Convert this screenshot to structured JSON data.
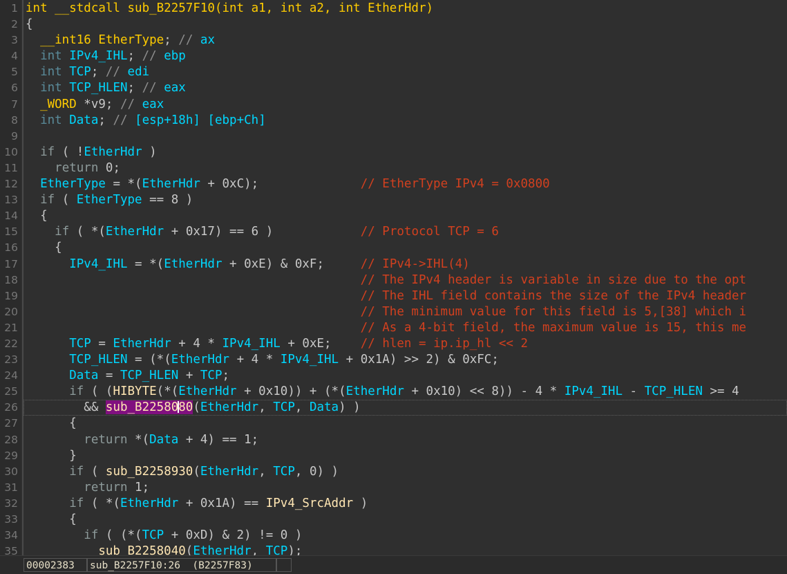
{
  "window": {
    "title": "IDA Pseudocode View",
    "background": "#2f2f2f",
    "gutter_background": "#2b2b2b"
  },
  "colors": {
    "background": "#2f2f2f",
    "gutter": "#2b2b2b",
    "line_number": "#767676",
    "declaration": "#ffcc00",
    "keyword": "#5a8b9a",
    "flow_keyword": "#8d9a9a",
    "variable": "#00d7ff",
    "function_name": "#ffe6b3",
    "comment": "#d1401f",
    "register_comment_slashes": "#8d8d8d",
    "register_name": "#00d7ff",
    "selection_highlight": "#80107f",
    "punctuation": "#c8c8c8",
    "caret": "#ffffff"
  },
  "editor": {
    "current_line": 26,
    "caret_token": "sub_B2258080",
    "caret_offset_in_token": 10,
    "first_line": 1,
    "last_line": 35,
    "total_visible_lines": 35
  },
  "code": {
    "lines": [
      {
        "n": 1,
        "tokens": [
          {
            "t": "int __stdcall sub_B2257F10(int a1, int a2, int EtherHdr)",
            "c": "t-decl"
          }
        ]
      },
      {
        "n": 2,
        "tokens": [
          {
            "t": "{",
            "c": "t-punct"
          }
        ]
      },
      {
        "n": 3,
        "tokens": [
          {
            "t": "  ",
            "c": "t-plain"
          },
          {
            "t": "__int16",
            "c": "t-type"
          },
          {
            "t": " ",
            "c": "t-plain"
          },
          {
            "t": "EtherType",
            "c": "t-type"
          },
          {
            "t": "; ",
            "c": "t-punct"
          },
          {
            "t": "//",
            "c": "t-rcmt-s"
          },
          {
            "t": " ",
            "c": "t-plain"
          },
          {
            "t": "ax",
            "c": "t-reg"
          }
        ]
      },
      {
        "n": 4,
        "tokens": [
          {
            "t": "  ",
            "c": "t-plain"
          },
          {
            "t": "int",
            "c": "t-kw"
          },
          {
            "t": " ",
            "c": "t-plain"
          },
          {
            "t": "IPv4_IHL",
            "c": "t-var"
          },
          {
            "t": "; ",
            "c": "t-punct"
          },
          {
            "t": "//",
            "c": "t-rcmt-s"
          },
          {
            "t": " ",
            "c": "t-plain"
          },
          {
            "t": "ebp",
            "c": "t-reg"
          }
        ]
      },
      {
        "n": 5,
        "tokens": [
          {
            "t": "  ",
            "c": "t-plain"
          },
          {
            "t": "int",
            "c": "t-kw"
          },
          {
            "t": " ",
            "c": "t-plain"
          },
          {
            "t": "TCP",
            "c": "t-var"
          },
          {
            "t": "; ",
            "c": "t-punct"
          },
          {
            "t": "//",
            "c": "t-rcmt-s"
          },
          {
            "t": " ",
            "c": "t-plain"
          },
          {
            "t": "edi",
            "c": "t-reg"
          }
        ]
      },
      {
        "n": 6,
        "tokens": [
          {
            "t": "  ",
            "c": "t-plain"
          },
          {
            "t": "int",
            "c": "t-kw"
          },
          {
            "t": " ",
            "c": "t-plain"
          },
          {
            "t": "TCP_HLEN",
            "c": "t-var"
          },
          {
            "t": "; ",
            "c": "t-punct"
          },
          {
            "t": "//",
            "c": "t-rcmt-s"
          },
          {
            "t": " ",
            "c": "t-plain"
          },
          {
            "t": "eax",
            "c": "t-reg"
          }
        ]
      },
      {
        "n": 7,
        "tokens": [
          {
            "t": "  ",
            "c": "t-plain"
          },
          {
            "t": "_WORD",
            "c": "t-type"
          },
          {
            "t": " *",
            "c": "t-punct"
          },
          {
            "t": "v9",
            "c": "t-plain"
          },
          {
            "t": "; ",
            "c": "t-punct"
          },
          {
            "t": "//",
            "c": "t-rcmt-s"
          },
          {
            "t": " ",
            "c": "t-plain"
          },
          {
            "t": "eax",
            "c": "t-reg"
          }
        ]
      },
      {
        "n": 8,
        "tokens": [
          {
            "t": "  ",
            "c": "t-plain"
          },
          {
            "t": "int",
            "c": "t-kw"
          },
          {
            "t": " ",
            "c": "t-plain"
          },
          {
            "t": "Data",
            "c": "t-var"
          },
          {
            "t": "; ",
            "c": "t-punct"
          },
          {
            "t": "//",
            "c": "t-rcmt-s"
          },
          {
            "t": " ",
            "c": "t-plain"
          },
          {
            "t": "[esp+18h] [ebp+Ch]",
            "c": "t-reg"
          }
        ]
      },
      {
        "n": 9,
        "tokens": []
      },
      {
        "n": 10,
        "tokens": [
          {
            "t": "  ",
            "c": "t-plain"
          },
          {
            "t": "if",
            "c": "t-flow"
          },
          {
            "t": " ( !",
            "c": "t-punct"
          },
          {
            "t": "EtherHdr",
            "c": "t-var"
          },
          {
            "t": " )",
            "c": "t-punct"
          }
        ]
      },
      {
        "n": 11,
        "tokens": [
          {
            "t": "    ",
            "c": "t-plain"
          },
          {
            "t": "return",
            "c": "t-flow"
          },
          {
            "t": " 0;",
            "c": "t-num"
          }
        ]
      },
      {
        "n": 12,
        "tokens": [
          {
            "t": "  ",
            "c": "t-plain"
          },
          {
            "t": "EtherType",
            "c": "t-var"
          },
          {
            "t": " = *(",
            "c": "t-punct"
          },
          {
            "t": "EtherHdr",
            "c": "t-var"
          },
          {
            "t": " + 0xC);",
            "c": "t-num"
          }
        ],
        "comment": "// EtherType IPv4 = 0x0800",
        "comment_col": 46
      },
      {
        "n": 13,
        "tokens": [
          {
            "t": "  ",
            "c": "t-plain"
          },
          {
            "t": "if",
            "c": "t-flow"
          },
          {
            "t": " ( ",
            "c": "t-punct"
          },
          {
            "t": "EtherType",
            "c": "t-var"
          },
          {
            "t": " == 8 )",
            "c": "t-num"
          }
        ]
      },
      {
        "n": 14,
        "tokens": [
          {
            "t": "  {",
            "c": "t-punct"
          }
        ]
      },
      {
        "n": 15,
        "tokens": [
          {
            "t": "    ",
            "c": "t-plain"
          },
          {
            "t": "if",
            "c": "t-flow"
          },
          {
            "t": " ( *(",
            "c": "t-punct"
          },
          {
            "t": "EtherHdr",
            "c": "t-var"
          },
          {
            "t": " + 0x17) == 6 )",
            "c": "t-num"
          }
        ],
        "comment": "// Protocol TCP = 6",
        "comment_col": 46
      },
      {
        "n": 16,
        "tokens": [
          {
            "t": "    {",
            "c": "t-punct"
          }
        ]
      },
      {
        "n": 17,
        "tokens": [
          {
            "t": "      ",
            "c": "t-plain"
          },
          {
            "t": "IPv4_IHL",
            "c": "t-var"
          },
          {
            "t": " = *(",
            "c": "t-punct"
          },
          {
            "t": "EtherHdr",
            "c": "t-var"
          },
          {
            "t": " + 0xE) & 0xF;",
            "c": "t-num"
          }
        ],
        "comment": "// IPv4->IHL(4)",
        "comment_col": 46
      },
      {
        "n": 18,
        "tokens": [],
        "comment": "// The IPv4 header is variable in size due to the opt",
        "comment_col": 46
      },
      {
        "n": 19,
        "tokens": [],
        "comment": "// The IHL field contains the size of the IPv4 header",
        "comment_col": 46
      },
      {
        "n": 20,
        "tokens": [],
        "comment": "// The minimum value for this field is 5,[38] which i",
        "comment_col": 46
      },
      {
        "n": 21,
        "tokens": [],
        "comment": "// As a 4-bit field, the maximum value is 15, this me",
        "comment_col": 46
      },
      {
        "n": 22,
        "tokens": [
          {
            "t": "      ",
            "c": "t-plain"
          },
          {
            "t": "TCP",
            "c": "t-var"
          },
          {
            "t": " = ",
            "c": "t-punct"
          },
          {
            "t": "EtherHdr",
            "c": "t-var"
          },
          {
            "t": " + 4 * ",
            "c": "t-num"
          },
          {
            "t": "IPv4_IHL",
            "c": "t-var"
          },
          {
            "t": " + 0xE;",
            "c": "t-num"
          }
        ],
        "comment": "// hlen = ip.ip_hl << 2",
        "comment_col": 46
      },
      {
        "n": 23,
        "tokens": [
          {
            "t": "      ",
            "c": "t-plain"
          },
          {
            "t": "TCP_HLEN",
            "c": "t-var"
          },
          {
            "t": " = (*(",
            "c": "t-punct"
          },
          {
            "t": "EtherHdr",
            "c": "t-var"
          },
          {
            "t": " + 4 * ",
            "c": "t-num"
          },
          {
            "t": "IPv4_IHL",
            "c": "t-var"
          },
          {
            "t": " + 0x1A) >> 2) & 0xFC;",
            "c": "t-num"
          }
        ]
      },
      {
        "n": 24,
        "tokens": [
          {
            "t": "      ",
            "c": "t-plain"
          },
          {
            "t": "Data",
            "c": "t-var"
          },
          {
            "t": " = ",
            "c": "t-punct"
          },
          {
            "t": "TCP_HLEN",
            "c": "t-var"
          },
          {
            "t": " + ",
            "c": "t-punct"
          },
          {
            "t": "TCP",
            "c": "t-var"
          },
          {
            "t": ";",
            "c": "t-punct"
          }
        ]
      },
      {
        "n": 25,
        "tokens": [
          {
            "t": "      ",
            "c": "t-plain"
          },
          {
            "t": "if",
            "c": "t-flow"
          },
          {
            "t": " ( (",
            "c": "t-punct"
          },
          {
            "t": "HIBYTE",
            "c": "t-fn"
          },
          {
            "t": "(*(",
            "c": "t-punct"
          },
          {
            "t": "EtherHdr",
            "c": "t-var"
          },
          {
            "t": " + 0x10)) + (*(",
            "c": "t-num"
          },
          {
            "t": "EtherHdr",
            "c": "t-var"
          },
          {
            "t": " + 0x10) << 8)) - 4 * ",
            "c": "t-num"
          },
          {
            "t": "IPv4_IHL",
            "c": "t-var"
          },
          {
            "t": " - ",
            "c": "t-punct"
          },
          {
            "t": "TCP_HLEN",
            "c": "t-var"
          },
          {
            "t": " >= 4",
            "c": "t-num"
          }
        ]
      },
      {
        "n": 26,
        "tokens": [
          {
            "t": "        && ",
            "c": "t-num"
          },
          {
            "t": "sub_B2258080",
            "c": "t-fn",
            "sel": true,
            "caret_at": 10
          },
          {
            "t": "(",
            "c": "t-punct"
          },
          {
            "t": "EtherHdr",
            "c": "t-var"
          },
          {
            "t": ", ",
            "c": "t-punct"
          },
          {
            "t": "TCP",
            "c": "t-var"
          },
          {
            "t": ", ",
            "c": "t-punct"
          },
          {
            "t": "Data",
            "c": "t-var"
          },
          {
            "t": ") )",
            "c": "t-punct"
          }
        ]
      },
      {
        "n": 27,
        "tokens": [
          {
            "t": "      {",
            "c": "t-punct"
          }
        ]
      },
      {
        "n": 28,
        "tokens": [
          {
            "t": "        ",
            "c": "t-plain"
          },
          {
            "t": "return",
            "c": "t-flow"
          },
          {
            "t": " *(",
            "c": "t-punct"
          },
          {
            "t": "Data",
            "c": "t-var"
          },
          {
            "t": " + 4) == 1;",
            "c": "t-num"
          }
        ]
      },
      {
        "n": 29,
        "tokens": [
          {
            "t": "      }",
            "c": "t-punct"
          }
        ]
      },
      {
        "n": 30,
        "tokens": [
          {
            "t": "      ",
            "c": "t-plain"
          },
          {
            "t": "if",
            "c": "t-flow"
          },
          {
            "t": " ( ",
            "c": "t-punct"
          },
          {
            "t": "sub_B2258930",
            "c": "t-fn"
          },
          {
            "t": "(",
            "c": "t-punct"
          },
          {
            "t": "EtherHdr",
            "c": "t-var"
          },
          {
            "t": ", ",
            "c": "t-punct"
          },
          {
            "t": "TCP",
            "c": "t-var"
          },
          {
            "t": ", 0) )",
            "c": "t-num"
          }
        ]
      },
      {
        "n": 31,
        "tokens": [
          {
            "t": "        ",
            "c": "t-plain"
          },
          {
            "t": "return",
            "c": "t-flow"
          },
          {
            "t": " 1;",
            "c": "t-num"
          }
        ]
      },
      {
        "n": 32,
        "tokens": [
          {
            "t": "      ",
            "c": "t-plain"
          },
          {
            "t": "if",
            "c": "t-flow"
          },
          {
            "t": " ( *(",
            "c": "t-punct"
          },
          {
            "t": "EtherHdr",
            "c": "t-var"
          },
          {
            "t": " + 0x1A) == ",
            "c": "t-num"
          },
          {
            "t": "IPv4_SrcAddr",
            "c": "t-fn"
          },
          {
            "t": " )",
            "c": "t-punct"
          }
        ]
      },
      {
        "n": 33,
        "tokens": [
          {
            "t": "      {",
            "c": "t-punct"
          }
        ]
      },
      {
        "n": 34,
        "tokens": [
          {
            "t": "        ",
            "c": "t-plain"
          },
          {
            "t": "if",
            "c": "t-flow"
          },
          {
            "t": " ( (*(",
            "c": "t-punct"
          },
          {
            "t": "TCP",
            "c": "t-var"
          },
          {
            "t": " + 0xD) & 2) != 0 )",
            "c": "t-num"
          }
        ]
      },
      {
        "n": 35,
        "tokens": [
          {
            "t": "          ",
            "c": "t-plain"
          },
          {
            "t": "sub_B2258040",
            "c": "t-fn"
          },
          {
            "t": "(",
            "c": "t-punct"
          },
          {
            "t": "EtherHdr",
            "c": "t-var"
          },
          {
            "t": ", ",
            "c": "t-punct"
          },
          {
            "t": "TCP",
            "c": "t-var"
          },
          {
            "t": ");",
            "c": "t-punct"
          }
        ]
      }
    ]
  },
  "status_bar": {
    "address": "00002383",
    "location": "sub_B2257F10:26  (B2257F83)",
    "extra": ""
  }
}
